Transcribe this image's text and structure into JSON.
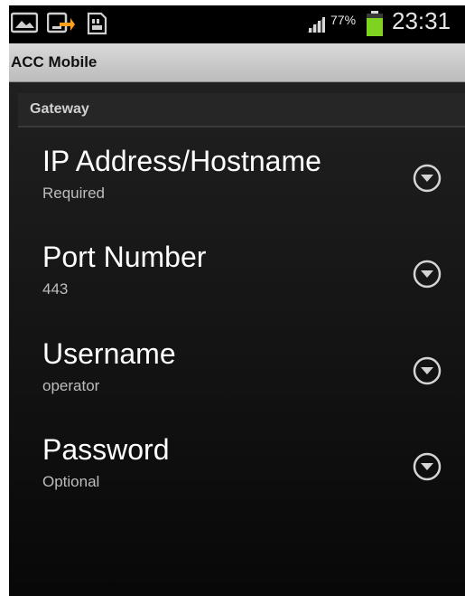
{
  "status_bar": {
    "icons": [
      "gallery-icon",
      "screen-share-icon",
      "sd-card-icon",
      "signal-icon",
      "battery-icon"
    ],
    "battery_percent": "77%",
    "time": "23:31",
    "battery_color": "#7ed321"
  },
  "title_bar": {
    "title": "ACC Mobile"
  },
  "section": {
    "header": "Gateway"
  },
  "preferences": [
    {
      "title": "IP Address/Hostname",
      "summary": "Required",
      "icon": "chevron-down-circle-icon"
    },
    {
      "title": "Port Number",
      "summary": "443",
      "icon": "chevron-down-circle-icon"
    },
    {
      "title": "Username",
      "summary": "operator",
      "icon": "chevron-down-circle-icon"
    },
    {
      "title": "Password",
      "summary": "Optional",
      "icon": "chevron-down-circle-icon"
    }
  ]
}
